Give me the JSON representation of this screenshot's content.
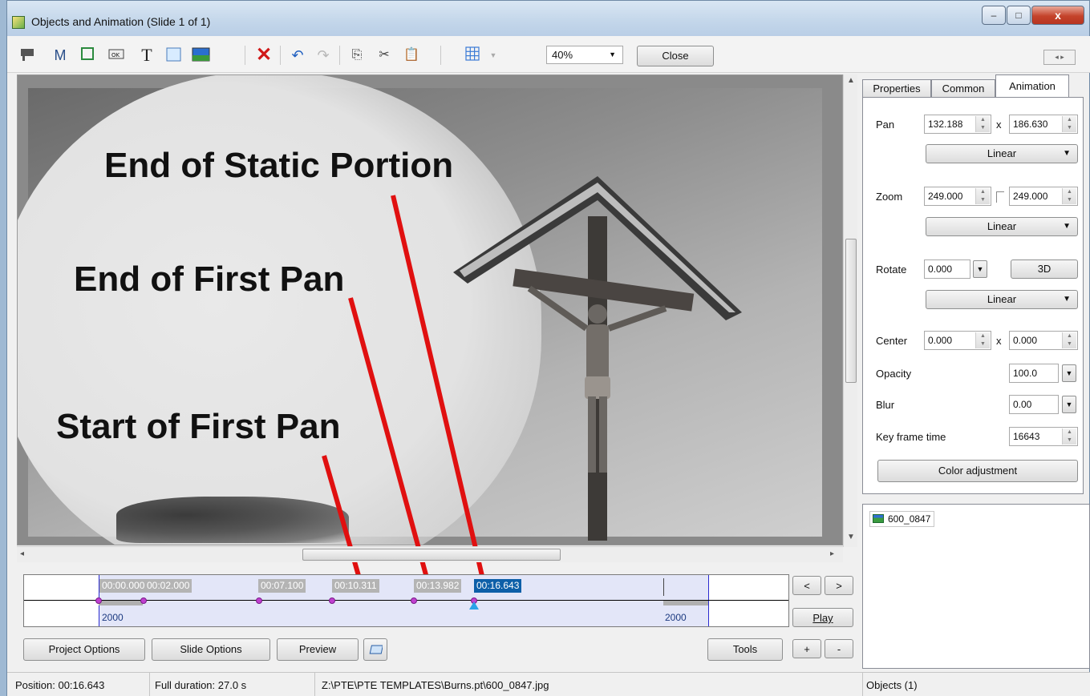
{
  "window": {
    "title": "Objects and Animation  (Slide 1 of 1)",
    "min": "–",
    "max": "□",
    "close": "x"
  },
  "toolbar": {
    "zoom": "40%",
    "close_label": "Close",
    "m_label": "M",
    "t_label": "T"
  },
  "canvas": {
    "annotations": {
      "end_static": "End of Static Portion",
      "end_first_pan": "End of First Pan",
      "start_first_pan": "Start of First Pan"
    }
  },
  "timeline": {
    "labels": [
      "00:00.000",
      "00:02.000",
      "00:07.100",
      "00:10.311",
      "00:13.982",
      "00:16.643"
    ],
    "active_label": "00:16.643",
    "start_value": "2000",
    "end_value": "2000"
  },
  "side_buttons": {
    "prev": "<",
    "next": ">",
    "play": "Play",
    "plus": "+",
    "minus": "-"
  },
  "bottom_buttons": {
    "project_options": "Project Options",
    "slide_options": "Slide Options",
    "preview": "Preview",
    "tools": "Tools"
  },
  "panel": {
    "tabs": [
      "Properties",
      "Common",
      "Animation"
    ],
    "active_tab": "Animation",
    "pan": {
      "label": "Pan",
      "x": "132.188",
      "y": "186.630",
      "sep": "x",
      "easing": "Linear"
    },
    "zoom": {
      "label": "Zoom",
      "x": "249.000",
      "y": "249.000",
      "easing": "Linear"
    },
    "rotate": {
      "label": "Rotate",
      "value": "0.000",
      "btn3d": "3D",
      "easing": "Linear"
    },
    "center": {
      "label": "Center",
      "x": "0.000",
      "y": "0.000",
      "sep": "x"
    },
    "opacity": {
      "label": "Opacity",
      "value": "100.0"
    },
    "blur": {
      "label": "Blur",
      "value": "0.00"
    },
    "keyframe": {
      "label": "Key frame time",
      "value": "16643"
    },
    "color_adjust": "Color adjustment"
  },
  "objects": {
    "items": [
      "600_0847"
    ]
  },
  "status": {
    "position": "Position: 00:16.643",
    "duration": "Full duration: 27.0 s",
    "path": "Z:\\PTE\\PTE TEMPLATES\\Burns.pt\\600_0847.jpg",
    "objects": "Objects (1)"
  },
  "colors": {
    "accent": "#0d5fa8",
    "marker": "#2aa3e8",
    "keyframe_dot": "#c040d0",
    "annotation_line": "#e01010"
  }
}
